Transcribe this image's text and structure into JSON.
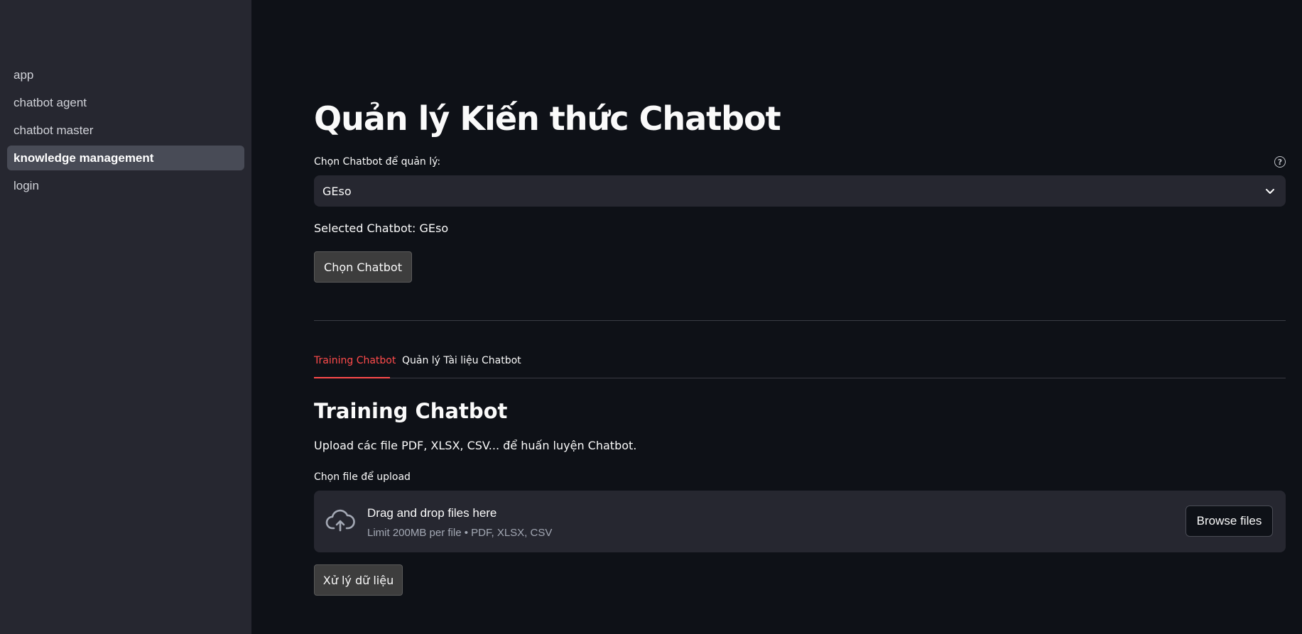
{
  "sidebar": {
    "items": [
      {
        "label": "app",
        "active": false
      },
      {
        "label": "chatbot agent",
        "active": false
      },
      {
        "label": "chatbot master",
        "active": false
      },
      {
        "label": "knowledge management",
        "active": true
      },
      {
        "label": "login",
        "active": false
      }
    ]
  },
  "main": {
    "title": "Quản lý Kiến thức Chatbot",
    "select": {
      "label": "Chọn Chatbot để quản lý:",
      "help_icon": "question-circle-icon",
      "value": "GEso",
      "chevron_icon": "chevron-down-icon"
    },
    "selected_text": "Selected Chatbot: GEso",
    "choose_button": "Chọn Chatbot",
    "tabs": [
      {
        "label": "Training Chatbot",
        "active": true
      },
      {
        "label": "Quản lý Tài liệu Chatbot",
        "active": false
      }
    ],
    "section_title": "Training Chatbot",
    "section_desc": "Upload các file PDF, XLSX, CSV... để huấn luyện Chatbot.",
    "upload": {
      "label": "Chọn file để upload",
      "icon": "cloud-upload-icon",
      "title": "Drag and drop files here",
      "subtitle": "Limit 200MB per file • PDF, XLSX, CSV",
      "browse_button": "Browse files"
    },
    "process_button": "Xử lý dữ liệu"
  },
  "colors": {
    "background": "#0e1117",
    "sidebar": "#262730",
    "accent": "#ff4b4b"
  }
}
